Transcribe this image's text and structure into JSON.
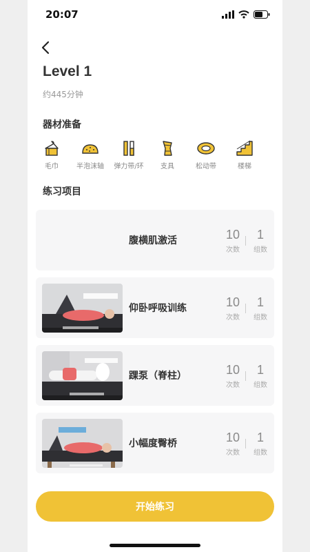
{
  "status_bar": {
    "time": "20:07"
  },
  "header": {
    "title": "Level 1",
    "duration": "约445分钟"
  },
  "equipment": {
    "section_title": "器材准备",
    "items": [
      {
        "label": "毛巾",
        "icon": "towel-icon"
      },
      {
        "label": "半泡沫轴",
        "icon": "foam-roller-icon"
      },
      {
        "label": "弹力带/环",
        "icon": "resistance-band-icon"
      },
      {
        "label": "支具",
        "icon": "brace-icon"
      },
      {
        "label": "松动带",
        "icon": "mobility-belt-icon"
      },
      {
        "label": "楼梯",
        "icon": "stairs-icon"
      }
    ]
  },
  "exercises": {
    "section_title": "练习项目",
    "items": [
      {
        "name": "腹横肌激活",
        "reps": "10",
        "reps_unit": "次数",
        "sets": "1",
        "sets_unit": "组数"
      },
      {
        "name": "仰卧呼吸训练",
        "reps": "10",
        "reps_unit": "次数",
        "sets": "1",
        "sets_unit": "组数"
      },
      {
        "name": "踝泵（脊柱）",
        "reps": "10",
        "reps_unit": "次数",
        "sets": "1",
        "sets_unit": "组数"
      },
      {
        "name": "小幅度臀桥",
        "reps": "10",
        "reps_unit": "次数",
        "sets": "1",
        "sets_unit": "组数"
      }
    ]
  },
  "footer": {
    "start_label": "开始练习"
  },
  "colors": {
    "accent": "#f0c236",
    "card_bg": "#f6f6f7",
    "text_dark": "#333333",
    "text_muted": "#999999"
  }
}
